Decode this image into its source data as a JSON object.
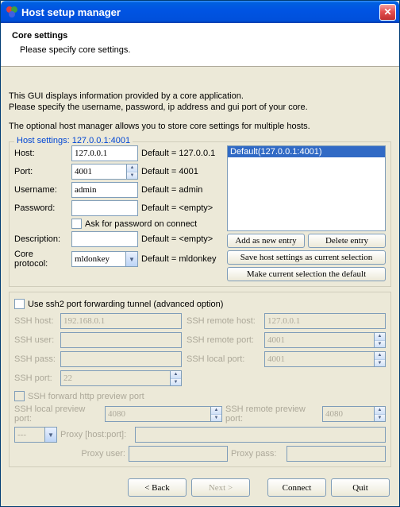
{
  "window": {
    "title": "Host setup manager"
  },
  "header": {
    "title": "Core settings",
    "subtitle": "Please specify core settings."
  },
  "info": {
    "line1": "This GUI displays information provided by a core application.",
    "line2": "Please specify the username, password, ip address and gui port of your core.",
    "line3": "The optional host manager allows you to store core settings for multiple hosts."
  },
  "host_settings": {
    "legend": "Host settings: 127.0.0.1:4001",
    "host_label": "Host:",
    "host_value": "127.0.0.1",
    "host_default": "Default = 127.0.0.1",
    "port_label": "Port:",
    "port_value": "4001",
    "port_default": "Default = 4001",
    "user_label": "Username:",
    "user_value": "admin",
    "user_default": "Default = admin",
    "pass_label": "Password:",
    "pass_value": "",
    "pass_default": "Default = <empty>",
    "ask_label": "Ask for password on connect",
    "desc_label": "Description:",
    "desc_value": "",
    "desc_default": "Default = <empty>",
    "proto_label": "Core protocol:",
    "proto_value": "mldonkey",
    "proto_default": "Default = mldonkey"
  },
  "hostlist": {
    "items": [
      "Default(127.0.0.1:4001)"
    ],
    "add": "Add as new entry",
    "delete": "Delete entry",
    "save": "Save host settings as current selection",
    "make_default": "Make current selection the default"
  },
  "ssh": {
    "use_label": "Use ssh2 port forwarding tunnel (advanced option)",
    "host_label": "SSH host:",
    "host_value": "192.168.0.1",
    "user_label": "SSH user:",
    "user_value": "",
    "pass_label": "SSH pass:",
    "pass_value": "",
    "port_label": "SSH port:",
    "port_value": "22",
    "rhost_label": "SSH remote host:",
    "rhost_value": "127.0.0.1",
    "rport_label": "SSH remote port:",
    "rport_value": "4001",
    "lport_label": "SSH local port:",
    "lport_value": "4001",
    "fwd_label": "SSH forward http preview port",
    "lpreview_label": "SSH local preview port:",
    "lpreview_value": "4080",
    "rpreview_label": "SSH remote preview port:",
    "rpreview_value": "4080"
  },
  "proxy": {
    "select_value": "---",
    "hostport_label": "Proxy [host:port]:",
    "hostport_value": "",
    "user_label": "Proxy user:",
    "user_value": "",
    "pass_label": "Proxy pass:",
    "pass_value": ""
  },
  "footer": {
    "back": "< Back",
    "next": "Next >",
    "connect": "Connect",
    "quit": "Quit"
  }
}
